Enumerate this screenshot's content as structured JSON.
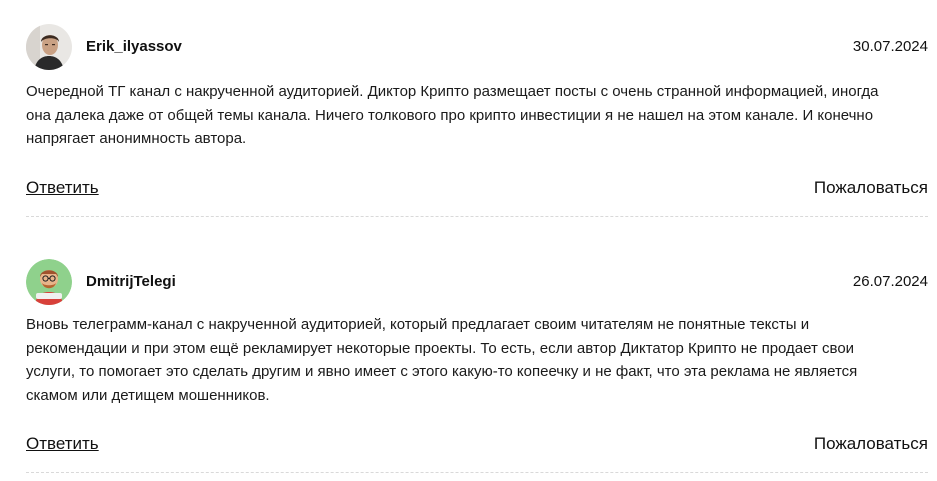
{
  "comments": [
    {
      "author": "Erik_ilyassov",
      "date": "30.07.2024",
      "avatar_icon": "user-photo-avatar",
      "text": "Очередной ТГ канал с накрученной аудиторией. Диктор Крипто размещает посты с очень странной информацией, иногда она далека даже от общей темы канала. Ничего толкового про крипто инвестиции я не нашел на этом канале. И конечно напрягает анонимность автора.",
      "reply_label": "Ответить",
      "report_label": "Пожаловаться"
    },
    {
      "author": "DmitrijTelegi",
      "date": "26.07.2024",
      "avatar_icon": "cartoon-avatar",
      "text": "Вновь телеграмм-канал с накрученной аудиторией, который предлагает своим читателям не понятные тексты и рекомендации и при этом ещё рекламирует некоторые проекты. То есть, если автор Диктатор Крипто не продает свои услуги, то помогает это сделать другим и явно имеет с этого какую-то копеечку и не факт, что эта реклама не является скамом или детищем мошенников.",
      "reply_label": "Ответить",
      "report_label": "Пожаловаться"
    }
  ],
  "colors": {
    "text": "#1a1a1a",
    "divider": "#d9d9d9",
    "avatar2_bg": "#8fd18c"
  }
}
